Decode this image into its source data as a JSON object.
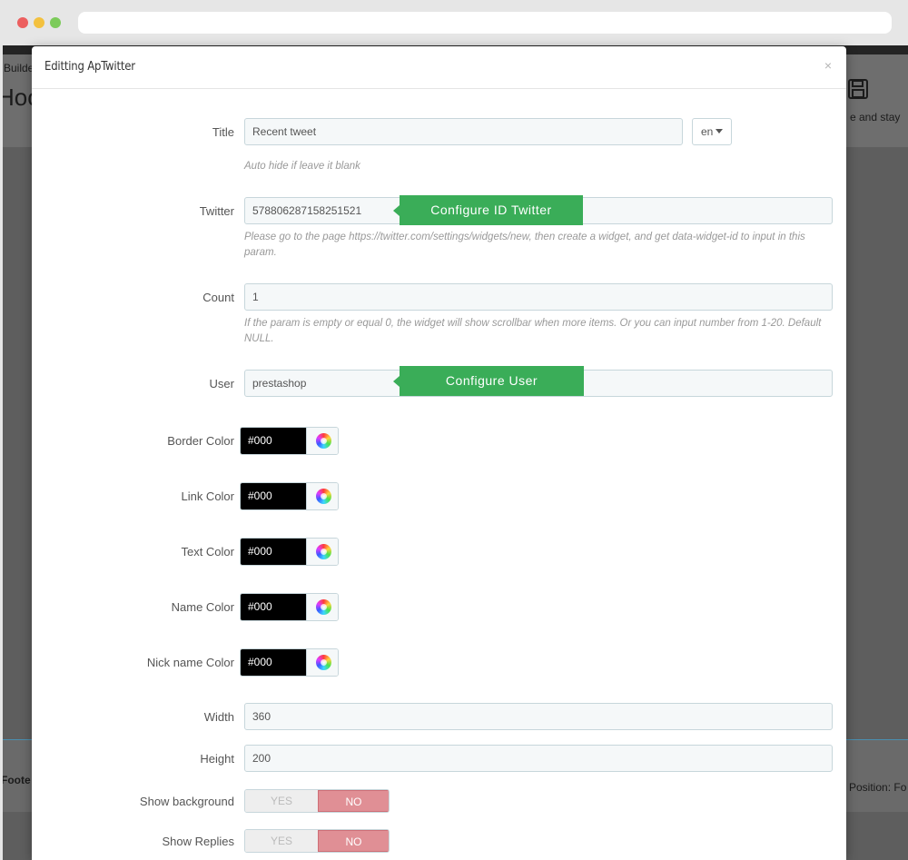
{
  "browser": {
    "url": ""
  },
  "background_page": {
    "breadcrumb": "Builde",
    "title": "Hoo",
    "save_label": "e and stay",
    "footer_label": "Foote",
    "position_text": "Position: Fo"
  },
  "modal": {
    "title": "Editting ApTwitter",
    "close_label": "×",
    "title_field": {
      "label": "Title",
      "value": "Recent tweet",
      "lang": "en",
      "hint": "Auto hide if leave it blank"
    },
    "twitter_field": {
      "label": "Twitter",
      "value": "578806287158251521",
      "tip": "Configure ID Twitter",
      "hint": "Please go to the page https://twitter.com/settings/widgets/new, then create a widget, and get data-widget-id to input in this param."
    },
    "count_field": {
      "label": "Count",
      "value": "1",
      "hint": "If the param is empty or equal 0, the widget will show scrollbar when more items. Or you can input number from 1-20. Default NULL."
    },
    "user_field": {
      "label": "User",
      "value": "prestashop",
      "tip": "Configure User"
    },
    "colors": [
      {
        "label": "Border Color",
        "value": "#000"
      },
      {
        "label": "Link Color",
        "value": "#000"
      },
      {
        "label": "Text Color",
        "value": "#000"
      },
      {
        "label": "Name Color",
        "value": "#000"
      },
      {
        "label": "Nick name Color",
        "value": "#000"
      }
    ],
    "width_field": {
      "label": "Width",
      "value": "360"
    },
    "height_field": {
      "label": "Height",
      "value": "200"
    },
    "show_background": {
      "label": "Show background",
      "yes": "YES",
      "no": "NO",
      "selected": "NO"
    },
    "show_replies": {
      "label": "Show Replies",
      "yes": "YES",
      "no": "NO",
      "selected": "NO"
    }
  },
  "colors_theme": {
    "accent_green": "#3aad58",
    "switch_no": "#e08f95"
  }
}
